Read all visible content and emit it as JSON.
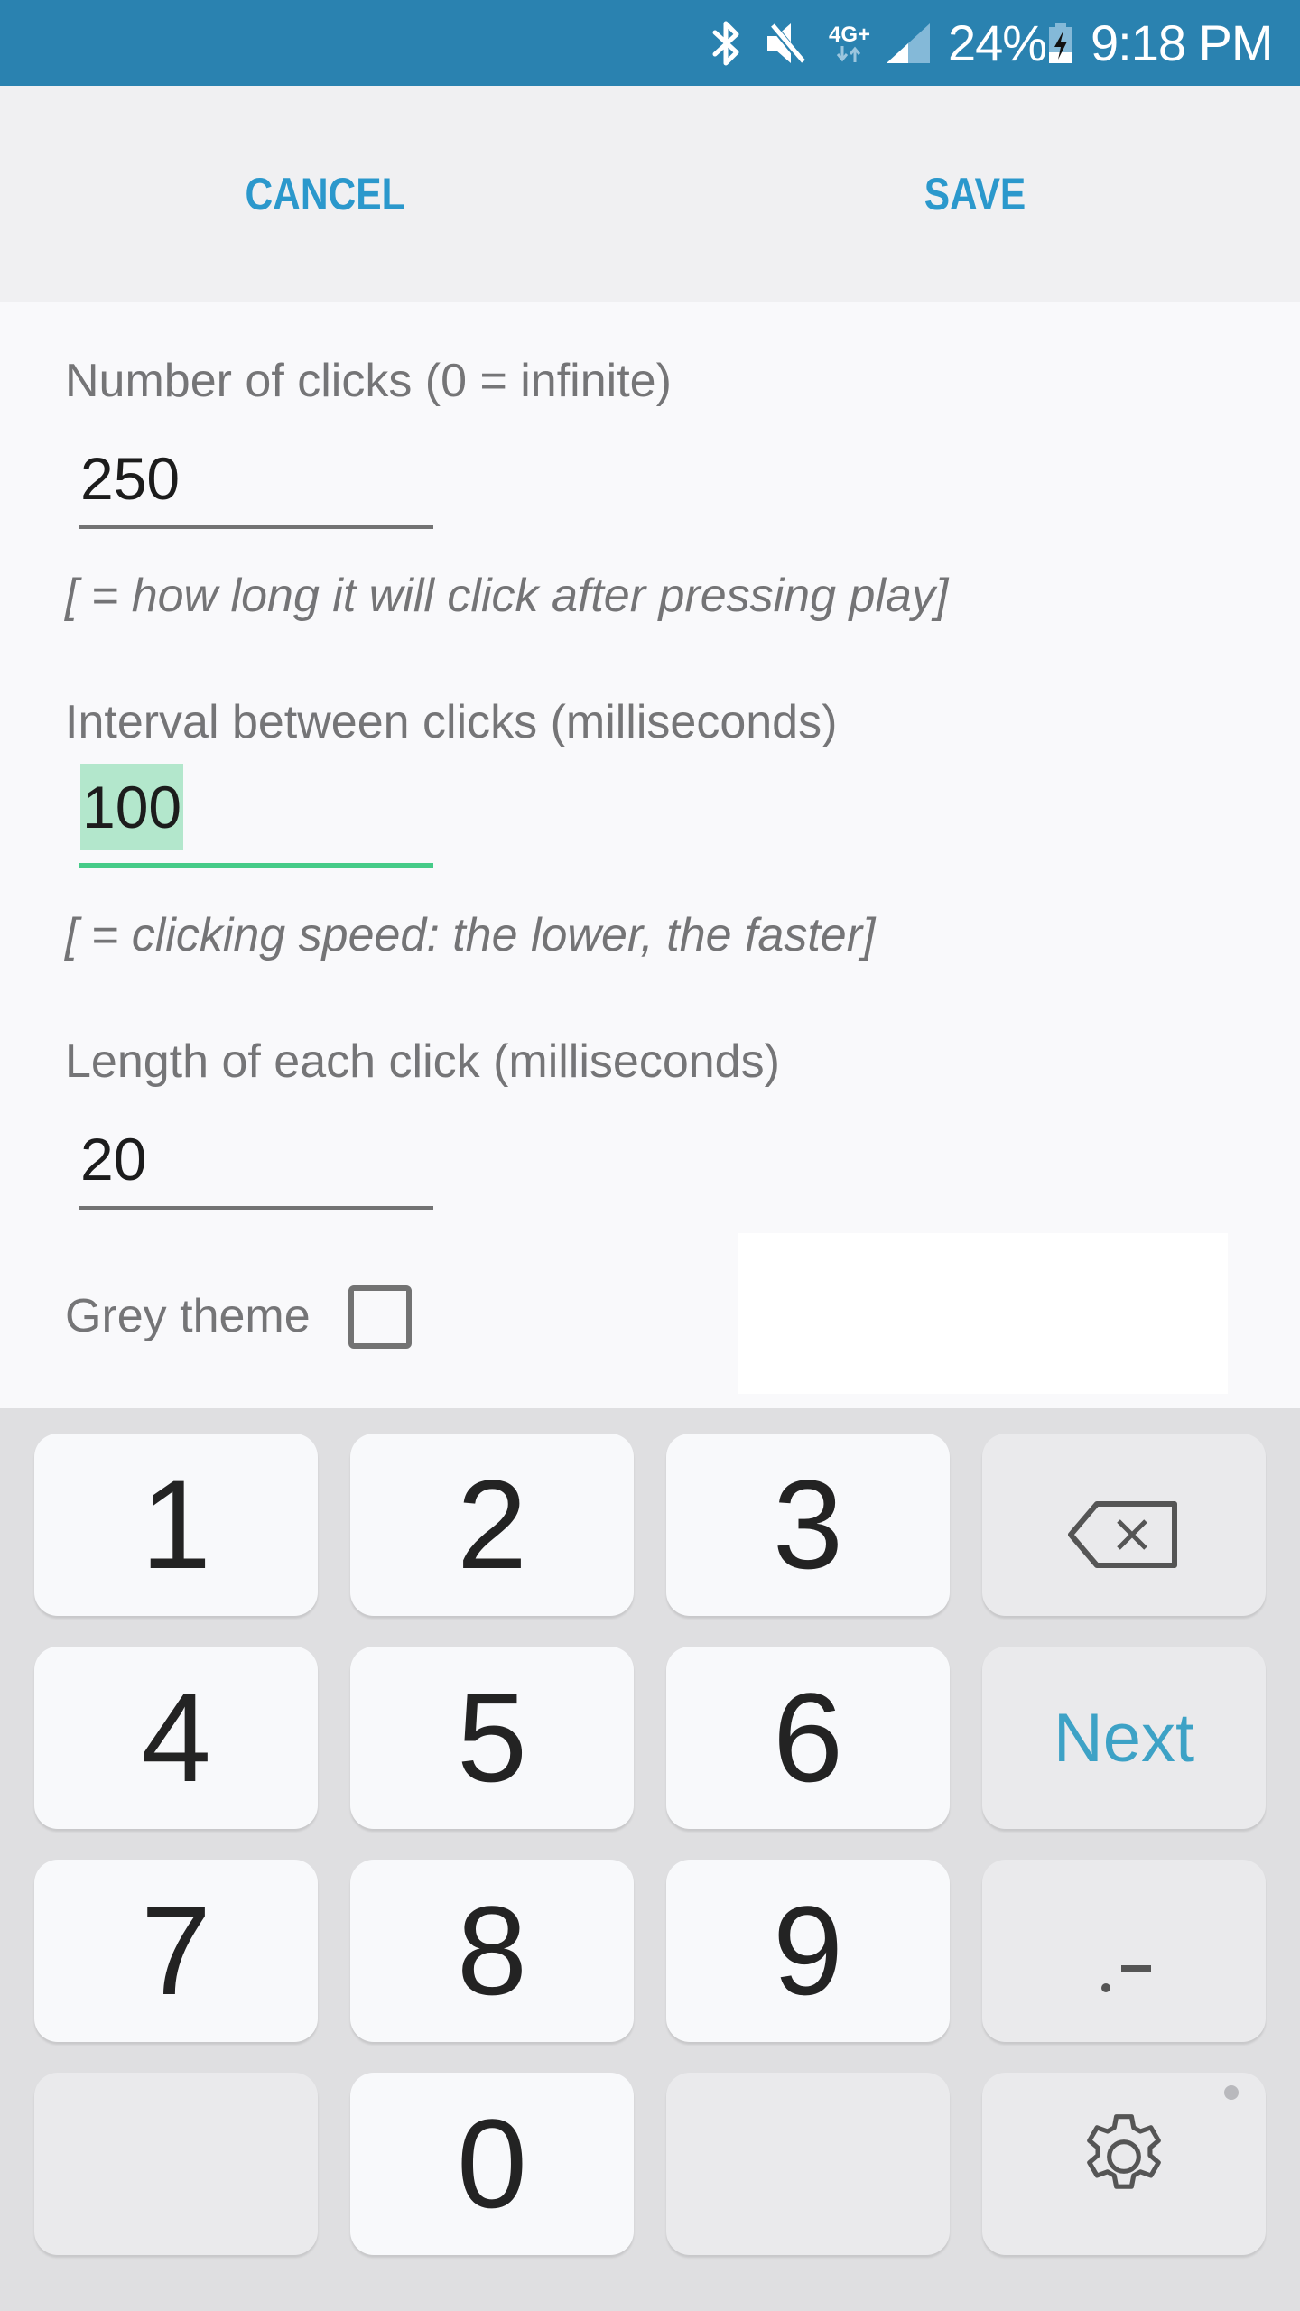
{
  "status_bar": {
    "icons": [
      "bluetooth-icon",
      "mute-icon",
      "network-4g-plus-icon",
      "signal-icon",
      "battery-charging-icon"
    ],
    "network_label": "4G+",
    "battery_percent": "24%",
    "time": "9:18 PM",
    "color": "#2a82b0"
  },
  "action_bar": {
    "cancel_label": "CANCEL",
    "save_label": "SAVE",
    "accent_color": "#2b98cc"
  },
  "form": {
    "clicks": {
      "label": "Number of clicks (0 = infinite)",
      "value": "250",
      "hint": "[ = how long it will click after pressing play]"
    },
    "interval": {
      "label": "Interval between clicks (milliseconds)",
      "value": "100",
      "hint": "[ = clicking speed: the lower, the faster]",
      "focused": true,
      "selected": true
    },
    "length": {
      "label": "Length of each click (milliseconds)",
      "value": "20"
    },
    "grey_theme": {
      "label": "Grey theme",
      "checked": false
    },
    "focus_color": "#46cb88"
  },
  "keyboard": {
    "rows": [
      [
        {
          "label": "1"
        },
        {
          "label": "2"
        },
        {
          "label": "3"
        },
        {
          "label": "",
          "icon": "backspace-icon"
        }
      ],
      [
        {
          "label": "4"
        },
        {
          "label": "5"
        },
        {
          "label": "6"
        },
        {
          "label": "Next"
        }
      ],
      [
        {
          "label": "7"
        },
        {
          "label": "8"
        },
        {
          "label": "9"
        },
        {
          "label": ".-"
        }
      ],
      [
        {
          "label": ""
        },
        {
          "label": "0"
        },
        {
          "label": ""
        },
        {
          "label": "",
          "icon": "settings-icon"
        }
      ]
    ],
    "next_color": "#3da2c6"
  }
}
